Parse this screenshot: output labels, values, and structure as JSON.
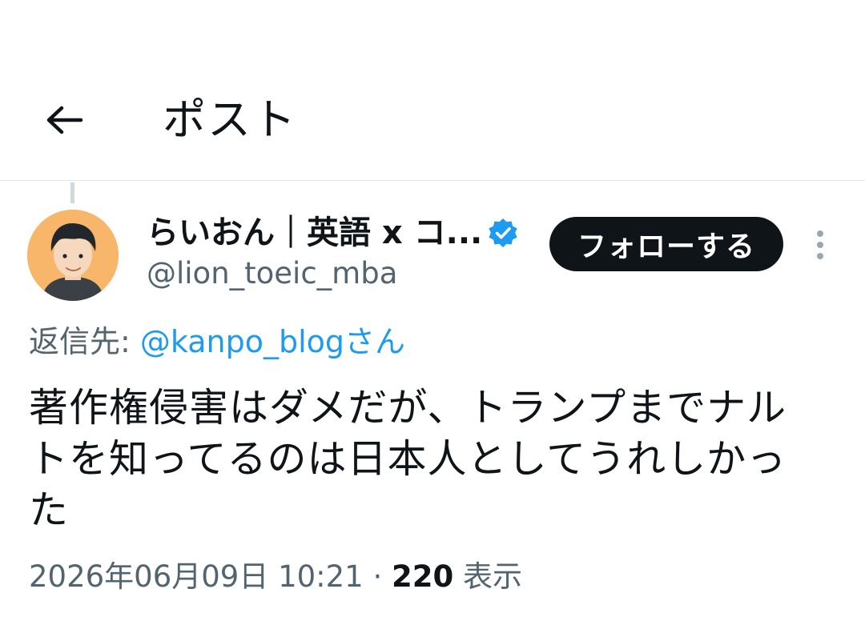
{
  "header": {
    "title": "ポスト",
    "back_icon": "arrow-left-icon"
  },
  "post": {
    "author": {
      "display_name": "らいおん｜英語 x コ...",
      "handle": "@lion_toeic_mba",
      "verified_icon": "verified-badge-icon",
      "verified_color": "#1d9bf0",
      "avatar_bg": "#f7b66a"
    },
    "follow_label": "フォローする",
    "more_icon": "more-vertical-icon",
    "reply_prefix": "返信先: ",
    "reply_target": "@kanpo_blogさん",
    "text_lines": [
      "著作権侵害はダメだが、トランプまでナル",
      "トを知ってるのは日本人としてうれしかっ",
      "た"
    ],
    "timestamp": "2026年06月09日 10:21",
    "separator": " · ",
    "views_count": "220",
    "views_label": " 表示"
  }
}
